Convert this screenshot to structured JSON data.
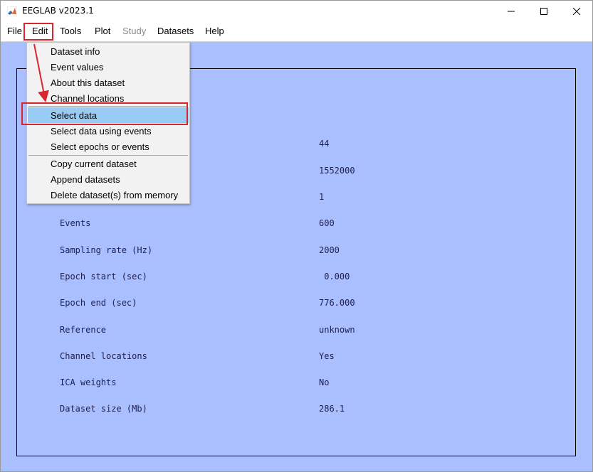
{
  "window": {
    "title": "EEGLAB v2023.1"
  },
  "menubar": {
    "items": [
      {
        "label": "File",
        "enabled": true
      },
      {
        "label": "Edit",
        "enabled": true
      },
      {
        "label": "Tools",
        "enabled": true
      },
      {
        "label": "Plot",
        "enabled": true
      },
      {
        "label": "Study",
        "enabled": false
      },
      {
        "label": "Datasets",
        "enabled": true
      },
      {
        "label": "Help",
        "enabled": true
      }
    ],
    "corner_glyph": "↘"
  },
  "edit_menu": {
    "items": [
      {
        "label": "Dataset info"
      },
      {
        "label": "Event values"
      },
      {
        "label": "About this dataset"
      },
      {
        "label": "Channel locations"
      },
      {
        "label": "Select data",
        "selected": true
      },
      {
        "label": "Select data using events"
      },
      {
        "label": "Select epochs or events"
      },
      {
        "label": "Copy current dataset"
      },
      {
        "label": "Append datasets"
      },
      {
        "label": "Delete dataset(s) from memory"
      }
    ]
  },
  "dataset_info": {
    "partial_values": [
      "44",
      "1552000",
      "1"
    ],
    "rows": [
      {
        "label": "Events",
        "value": "600"
      },
      {
        "label": "Sampling rate (Hz)",
        "value": "2000"
      },
      {
        "label": "Epoch start (sec)",
        "value": " 0.000"
      },
      {
        "label": "Epoch end (sec)",
        "value": "776.000"
      },
      {
        "label": "Reference",
        "value": "unknown"
      },
      {
        "label": "Channel locations",
        "value": "Yes"
      },
      {
        "label": "ICA weights",
        "value": "No"
      },
      {
        "label": "Dataset size (Mb)",
        "value": "286.1"
      }
    ]
  },
  "colors": {
    "background_blue": "#aabfff",
    "highlight_red": "#d8262e",
    "menu_selected": "#99ccf5",
    "text_dark": "#202050"
  },
  "icons": {
    "app": "matlab-logo-icon",
    "minimize": "minimize-icon",
    "maximize": "maximize-icon",
    "close": "close-icon"
  }
}
